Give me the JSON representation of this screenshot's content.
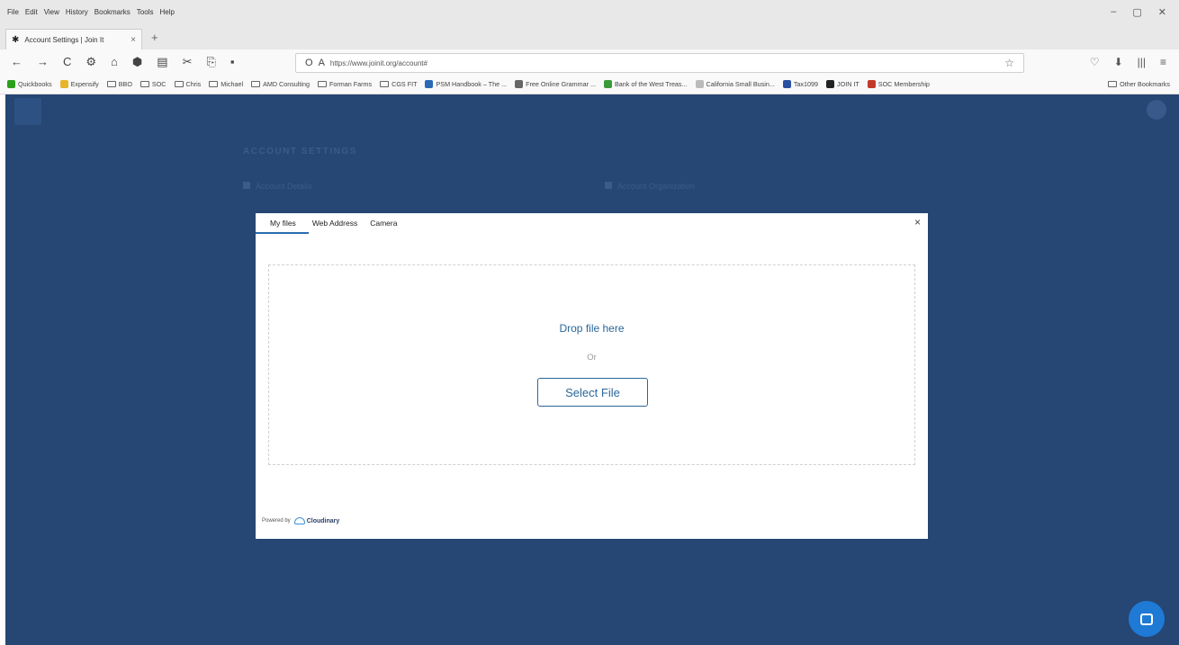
{
  "browser": {
    "menus": [
      "File",
      "Edit",
      "View",
      "History",
      "Bookmarks",
      "Tools",
      "Help"
    ],
    "window_controls": [
      "–",
      "▢",
      "✕"
    ],
    "tab": {
      "title": "Account Settings | Join It",
      "close": "×"
    },
    "new_tab": "+",
    "nav_buttons": [
      "←",
      "→",
      "C",
      "⚙",
      "⌂",
      "⬢",
      "▤",
      "✂",
      "⎘",
      "▪"
    ],
    "url": "https://www.joinit.org/account#",
    "url_icons": [
      "O",
      "A"
    ],
    "star": "☆",
    "toolbar_right": [
      "♡",
      "⬇",
      "|||",
      "≡"
    ],
    "bookmarks": [
      {
        "label": "Quickbooks",
        "icon": "green-circle-icon",
        "color": "#2ca01c"
      },
      {
        "label": "Expensify",
        "icon": "expensify-icon",
        "color": "#e8b42b"
      },
      {
        "label": "BBO",
        "icon": "folder-icon"
      },
      {
        "label": "SOC",
        "icon": "folder-icon"
      },
      {
        "label": "Chris",
        "icon": "folder-icon"
      },
      {
        "label": "Michael",
        "icon": "folder-icon"
      },
      {
        "label": "AMD Consulting",
        "icon": "folder-icon"
      },
      {
        "label": "Forman Farms",
        "icon": "folder-icon"
      },
      {
        "label": "CGS FIT",
        "icon": "folder-icon"
      },
      {
        "label": "PSM Handbook – The ...",
        "icon": "psm-icon",
        "color": "#2a6ab5"
      },
      {
        "label": "Free Online Grammar ...",
        "icon": "globe-icon",
        "color": "#666"
      },
      {
        "label": "Bank of the West Treas...",
        "icon": "bank-icon",
        "color": "#3a9a3a"
      },
      {
        "label": "California Small Busin...",
        "icon": "ca-icon",
        "color": "#bbb"
      },
      {
        "label": "Tax1099",
        "icon": "tax-icon",
        "color": "#2b4fa0"
      },
      {
        "label": "JOIN IT",
        "icon": "joinit-icon",
        "color": "#222"
      },
      {
        "label": "SOC Membership",
        "icon": "soc-icon",
        "color": "#c43a2a"
      }
    ],
    "other_bookmarks": "Other Bookmarks"
  },
  "page": {
    "heading": "ACCOUNT SETTINGS",
    "section_left": "Account Details",
    "section_right": "Account Organization",
    "background": "#264673"
  },
  "modal": {
    "tabs": [
      "My files",
      "Web Address",
      "Camera"
    ],
    "active_tab": "My files",
    "close": "×",
    "drop_text": "Drop file here",
    "or_text": "Or",
    "select_button": "Select File",
    "powered_by": "Powered by",
    "brand": "Cloudinary"
  },
  "colors": {
    "accent": "#2b6699",
    "tab_underline": "#2b6cb0",
    "chat": "#1f7ad6"
  }
}
